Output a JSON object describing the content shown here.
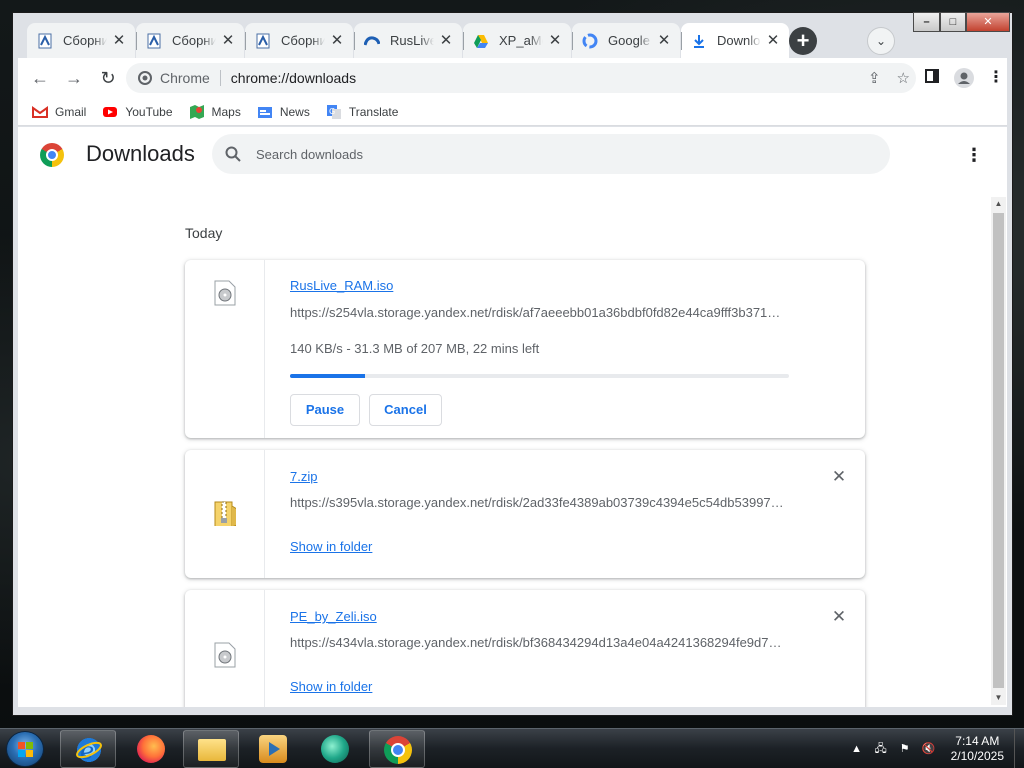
{
  "browser": {
    "tabs": [
      {
        "title": "Сборни",
        "icon": "doc-icon",
        "active": false
      },
      {
        "title": "Сборни",
        "icon": "doc-icon",
        "active": false
      },
      {
        "title": "Сборни",
        "icon": "doc-icon",
        "active": false
      },
      {
        "title": "RusLive_",
        "icon": "cloud-icon",
        "active": false
      },
      {
        "title": "XP_aMo",
        "icon": "drive-icon",
        "active": false
      },
      {
        "title": "Google",
        "icon": "google-icon",
        "active": false
      },
      {
        "title": "Downlo",
        "icon": "download-icon",
        "active": true
      }
    ],
    "tab_close_glyph": "✕",
    "new_tab_glyph": "+",
    "omnibox": {
      "site": "Chrome",
      "url": "chrome://downloads"
    },
    "bookmarks": [
      {
        "label": "Gmail",
        "icon": "gmail-icon"
      },
      {
        "label": "YouTube",
        "icon": "youtube-icon"
      },
      {
        "label": "Maps",
        "icon": "maps-icon"
      },
      {
        "label": "News",
        "icon": "news-icon"
      },
      {
        "label": "Translate",
        "icon": "translate-icon"
      }
    ]
  },
  "page": {
    "title": "Downloads",
    "search": {
      "placeholder": "Search downloads",
      "value": ""
    },
    "day_label": "Today",
    "downloads": [
      {
        "name": "RusLive_RAM.iso",
        "url": "https://s254vla.storage.yandex.net/rdisk/af7aeeebb01a36bdbf0fd82e44ca9fff3b371…",
        "status": "140 KB/s - 31.3 MB of 207 MB, 22 mins left",
        "progress": 0.15,
        "pause_label": "Pause",
        "cancel_label": "Cancel",
        "icon": "disc-file-icon"
      },
      {
        "name": "7.zip",
        "url": "https://s395vla.storage.yandex.net/rdisk/2ad33fe4389ab03739c4394e5c54db53997…",
        "link_label": "Show in folder",
        "icon": "zip-file-icon"
      },
      {
        "name": "PE_by_Zeli.iso",
        "url": "https://s434vla.storage.yandex.net/rdisk/bf368434294d13a4e04a4241368294fe9d7…",
        "link_label": "Show in folder",
        "icon": "disc-file-icon"
      }
    ]
  },
  "taskbar": {
    "time": "7:14 AM",
    "date": "2/10/2025",
    "apps": [
      "ie-icon",
      "firefox-icon",
      "explorer-icon",
      "media-player-icon",
      "app-icon",
      "chrome-icon"
    ]
  },
  "colors": {
    "accent": "#1a73e8",
    "tab_active": "#ffffff",
    "frame": "#dee1e6"
  }
}
